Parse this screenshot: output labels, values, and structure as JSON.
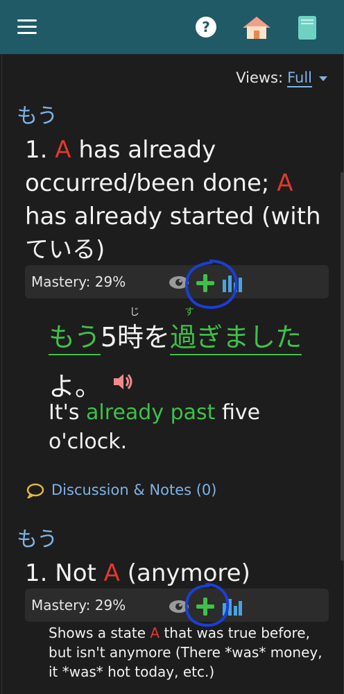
{
  "header": {
    "menu_icon": "hamburger-menu-icon",
    "help_icon": "question-circle-icon",
    "home_icon": "house-icon",
    "book_icon": "book-icon",
    "colors": {
      "bar": "#1f5a66",
      "home_roof": "#f0a08a"
    }
  },
  "views": {
    "label": "Views:",
    "value": "Full"
  },
  "entry1": {
    "kana": "もう",
    "meaning": {
      "num": "1.",
      "a1": "A",
      "part1": "has already occurred/been done;",
      "a2": "A",
      "part2": "has already started (with ている)"
    },
    "mastery": "Mastery: 29%",
    "example": {
      "jp_word1": "もう",
      "jp_mid": "5時を",
      "jp_word2": "過ぎました",
      "jp_end": "よ。",
      "furigana_ji": "じ",
      "furigana_su": "す",
      "en_pre": "It's",
      "en_green": "already past",
      "en_post": "five o'clock."
    },
    "discussion": "Discussion & Notes (0)"
  },
  "entry2": {
    "kana": "もう",
    "meaning": {
      "num": "1.",
      "pre": "Not",
      "a": "A",
      "post": "(anymore)"
    },
    "mastery": "Mastery: 29%",
    "desc": {
      "pre": "Shows a state",
      "a": "A",
      "post": "that was true before, but isn't anymore (There *was* money, it *was* hot today, etc.)"
    }
  },
  "colors": {
    "accent_blue": "#7fb3e6",
    "green": "#3fc04a",
    "red": "#e0392f",
    "annotation": "#1a3fd6"
  }
}
